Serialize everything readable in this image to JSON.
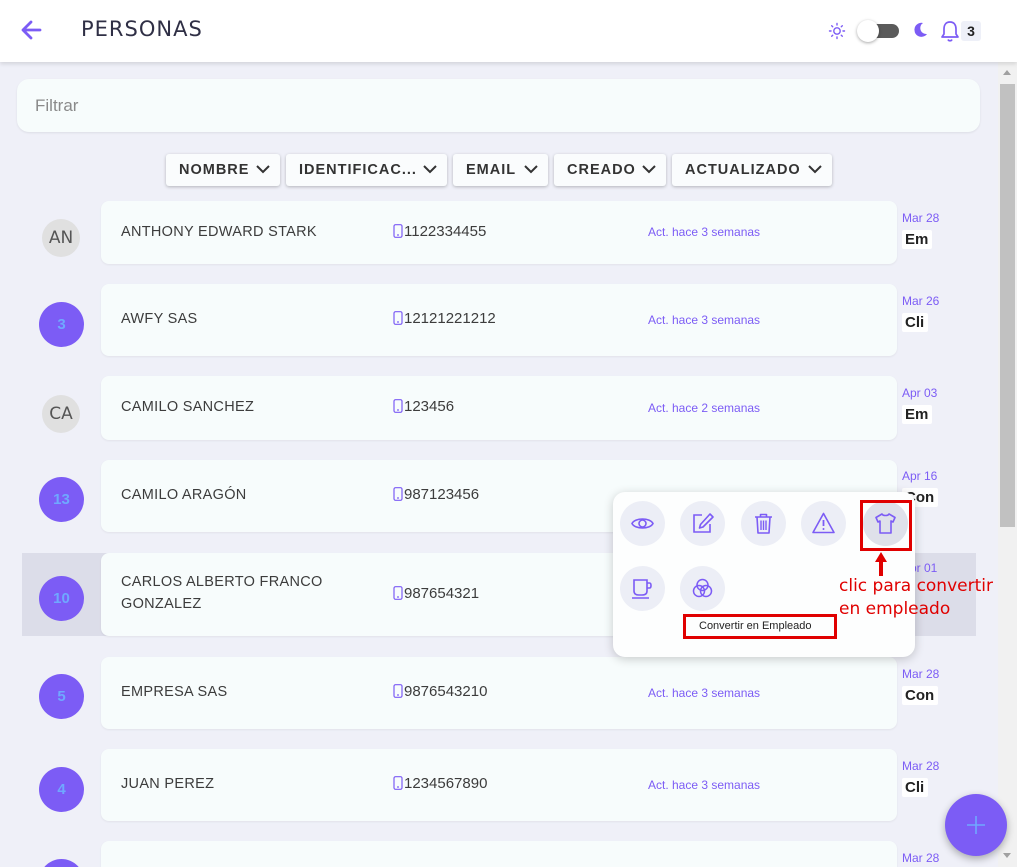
{
  "header": {
    "title": "PERSONAS",
    "notification_count": "3",
    "icons": [
      "back-arrow-icon",
      "sun-icon",
      "theme-toggle",
      "moon-icon",
      "bell-icon"
    ]
  },
  "filter": {
    "placeholder": "Filtrar"
  },
  "sort_buttons": [
    "NOMBRE",
    "IDENTIFICAC...",
    "EMAIL",
    "CREADO",
    "ACTUALIZADO"
  ],
  "people": [
    {
      "avatar": "AN",
      "avatar_type": "initials",
      "name": "ANTHONY EDWARD STARK",
      "phone": "1122334455",
      "updated": "Act. hace 3 semanas",
      "date": "Mar 28",
      "type": "Em"
    },
    {
      "avatar": "3",
      "avatar_type": "count",
      "name": "AWFY SAS",
      "phone": "12121221212",
      "updated": "Act. hace 3 semanas",
      "date": "Mar 26",
      "type": "Cli"
    },
    {
      "avatar": "CA",
      "avatar_type": "initials",
      "name": "CAMILO SANCHEZ",
      "phone": "123456",
      "updated": "Act. hace 2 semanas",
      "date": "Apr 03",
      "type": "Em"
    },
    {
      "avatar": "13",
      "avatar_type": "count",
      "name": "CAMILO ARAGÓN",
      "phone": "987123456",
      "updated": "",
      "date": "Apr 16",
      "type": "Con"
    },
    {
      "avatar": "10",
      "avatar_type": "count",
      "name": "CARLOS ALBERTO FRANCO GONZALEZ",
      "phone": "987654321",
      "updated": "",
      "date": "Apr 01",
      "type": ""
    },
    {
      "avatar": "5",
      "avatar_type": "count",
      "name": "EMPRESA SAS",
      "phone": "9876543210",
      "updated": "Act. hace 3 semanas",
      "date": "Mar 28",
      "type": "Con"
    },
    {
      "avatar": "4",
      "avatar_type": "count",
      "name": "JUAN PEREZ",
      "phone": "1234567890",
      "updated": "Act. hace 3 semanas",
      "date": "Mar 28",
      "type": "Cli"
    },
    {
      "avatar": "",
      "avatar_type": "count",
      "name": "",
      "phone": "",
      "updated": "",
      "date": "Mar 28",
      "type": ""
    }
  ],
  "popup": {
    "actions": [
      "eye-icon",
      "edit-icon",
      "trash-icon",
      "warning-icon",
      "shirt-icon",
      "coffee-cup-icon",
      "circles-icon"
    ],
    "tooltip": "Convertir en Empleado"
  },
  "annotation": {
    "line1": "clic para convertir",
    "line2": "en empleado"
  },
  "colors": {
    "accent": "#7c5cf5",
    "annotation": "#e00000"
  }
}
